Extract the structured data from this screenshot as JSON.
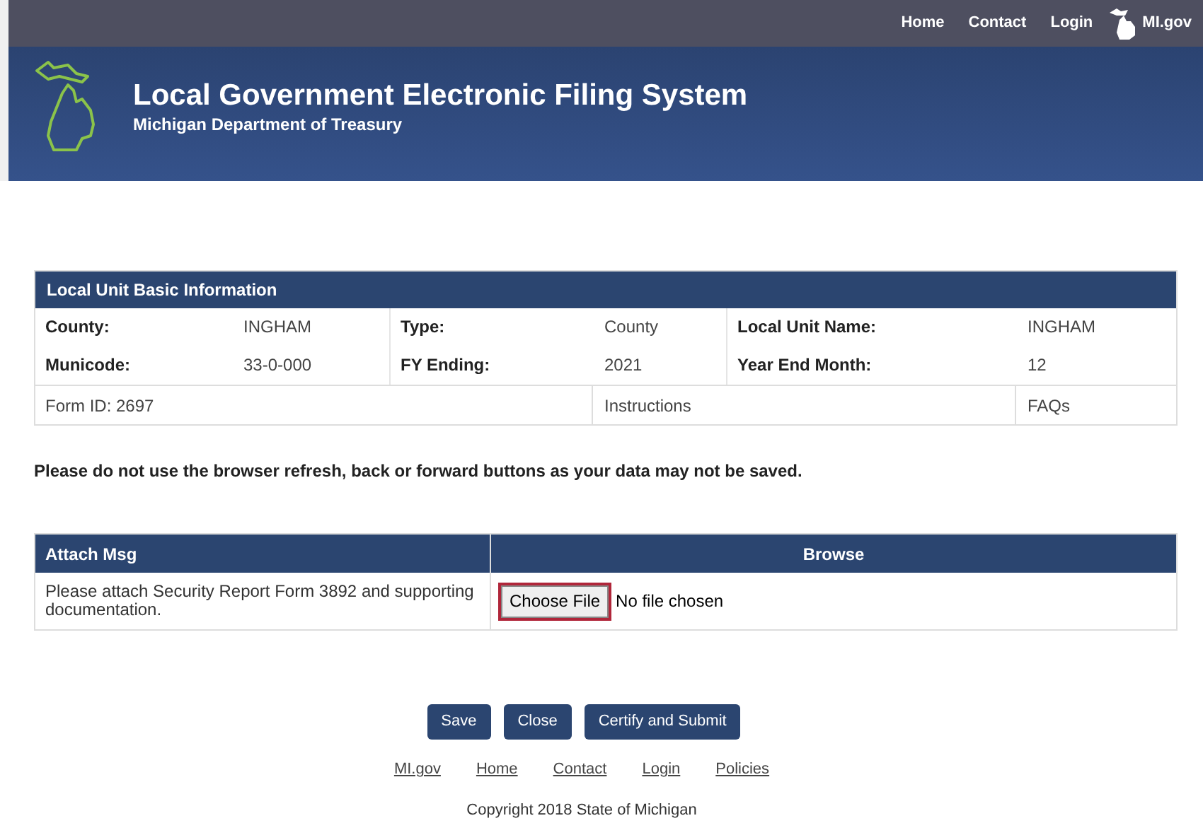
{
  "top_nav": {
    "links": [
      "Home",
      "Contact",
      "Login"
    ],
    "state_link": "MI.gov"
  },
  "banner": {
    "title": "Local Government Electronic Filing System",
    "subtitle": "Michigan Department of Treasury"
  },
  "info_card": {
    "title": "Local Unit Basic Information",
    "fields": [
      {
        "label": "County:",
        "value": "INGHAM"
      },
      {
        "label": "Type:",
        "value": "County"
      },
      {
        "label": "Local Unit Name:",
        "value": "INGHAM"
      },
      {
        "label": "Municode:",
        "value": "33-0-000"
      },
      {
        "label": "FY Ending:",
        "value": "2021"
      },
      {
        "label": "Year End Month:",
        "value": "12"
      }
    ],
    "footer_row": {
      "form_id": "Form ID: 2697",
      "instructions": "Instructions",
      "faqs": "FAQs"
    }
  },
  "warning": "Please do not use the browser refresh, back or forward buttons as your data may not be saved.",
  "attach_table": {
    "columns": [
      "Attach Msg",
      "Browse"
    ],
    "row": {
      "message": "Please attach Security Report Form 3892 and supporting documentation.",
      "file_button": "Choose File",
      "file_status": "No file chosen"
    }
  },
  "buttons": [
    "Save",
    "Close",
    "Certify and Submit"
  ],
  "footer_links": [
    "MI.gov",
    "Home",
    "Contact",
    "Login",
    "Policies"
  ],
  "copyright": "Copyright 2018 State of Michigan"
}
